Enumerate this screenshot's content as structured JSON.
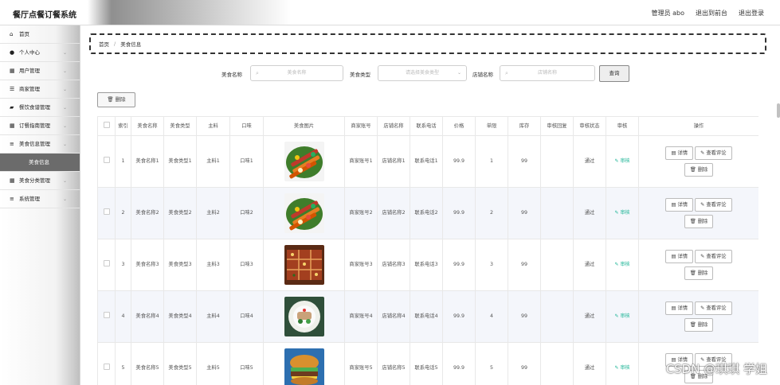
{
  "app": {
    "title": "餐厅点餐订餐系统"
  },
  "header": {
    "links": [
      "管理员 abo",
      "退出到前台",
      "退出登录"
    ]
  },
  "sidebar": {
    "items": [
      {
        "label": "首页",
        "icon": "home-icon",
        "glyph": "⌂",
        "chev": false
      },
      {
        "label": "个人中心",
        "icon": "user-icon",
        "glyph": "●",
        "chev": true
      },
      {
        "label": "用户管理",
        "icon": "grid-icon",
        "glyph": "▦",
        "chev": true
      },
      {
        "label": "商家管理",
        "icon": "sliders-icon",
        "glyph": "☰",
        "chev": true
      },
      {
        "label": "餐饮食谱管理",
        "icon": "book-icon",
        "glyph": "▰",
        "chev": true
      },
      {
        "label": "订餐指南管理",
        "icon": "grid-icon",
        "glyph": "▦",
        "chev": true
      },
      {
        "label": "美食信息管理",
        "icon": "list-icon",
        "glyph": "≡",
        "chev": true
      },
      {
        "label": "美食信息",
        "icon": "",
        "glyph": "",
        "chev": false,
        "sub": true
      },
      {
        "label": "美食分类管理",
        "icon": "grid-icon",
        "glyph": "▦",
        "chev": true
      },
      {
        "label": "系统管理",
        "icon": "list-icon",
        "glyph": "≡",
        "chev": true
      }
    ]
  },
  "breadcrumb": {
    "home": "首页",
    "sep": "/",
    "current": "美食信息"
  },
  "search": {
    "name_label": "美食名称",
    "name_placeholder": "美食名称",
    "type_label": "美食类型",
    "type_placeholder": "请选择美食类型",
    "shop_label": "店铺名称",
    "shop_placeholder": "店铺名称",
    "search_button": "查询"
  },
  "toolbar": {
    "delete_label": "删除",
    "delete_icon": "trash-icon"
  },
  "table": {
    "headers": [
      "",
      "索引",
      "美食名称",
      "美食类型",
      "主料",
      "口味",
      "美食图片",
      "商家账号",
      "店铺名称",
      "联系电话",
      "价格",
      "单限",
      "库存",
      "审核回复",
      "审核状态",
      "审核",
      "操作"
    ],
    "rows": [
      {
        "index": "1",
        "name": "美食名称1",
        "type": "美食类型1",
        "main": "主料1",
        "taste": "口味1",
        "img": "skewers",
        "account": "商家账号1",
        "shop": "店铺名称1",
        "phone": "联系电话1",
        "price": "99.9",
        "limit": "1",
        "stock": "99",
        "reply": "",
        "status": "通过",
        "audit": "审核"
      },
      {
        "index": "2",
        "name": "美食名称2",
        "type": "美食类型2",
        "main": "主料2",
        "taste": "口味2",
        "img": "skewers",
        "account": "商家账号2",
        "shop": "店铺名称2",
        "phone": "联系电话2",
        "price": "99.9",
        "limit": "2",
        "stock": "99",
        "reply": "",
        "status": "通过",
        "audit": "审核"
      },
      {
        "index": "3",
        "name": "美食名称3",
        "type": "美食类型3",
        "main": "主料3",
        "taste": "口味3",
        "img": "pizza",
        "account": "商家账号3",
        "shop": "店铺名称3",
        "phone": "联系电话3",
        "price": "99.9",
        "limit": "3",
        "stock": "99",
        "reply": "",
        "status": "通过",
        "audit": "审核"
      },
      {
        "index": "4",
        "name": "美食名称4",
        "type": "美食类型4",
        "main": "主料4",
        "taste": "口味4",
        "img": "plate",
        "account": "商家账号4",
        "shop": "店铺名称4",
        "phone": "联系电话4",
        "price": "99.9",
        "limit": "4",
        "stock": "99",
        "reply": "",
        "status": "通过",
        "audit": "审核"
      },
      {
        "index": "5",
        "name": "美食名称5",
        "type": "美食类型5",
        "main": "主料5",
        "taste": "口味5",
        "img": "burger",
        "account": "商家账号5",
        "shop": "店铺名称5",
        "phone": "联系电话5",
        "price": "99.9",
        "limit": "5",
        "stock": "99",
        "reply": "",
        "status": "通过",
        "audit": "审核"
      }
    ],
    "ops": {
      "detail": "详情",
      "comments": "查看评论",
      "delete": "删除"
    }
  },
  "watermark": "CSDN @琪琪 学姐",
  "colors": {
    "audit_green": "#19b394",
    "sub_menu_bg": "#6b6b6b",
    "row_alt": "#f4f6fb"
  }
}
